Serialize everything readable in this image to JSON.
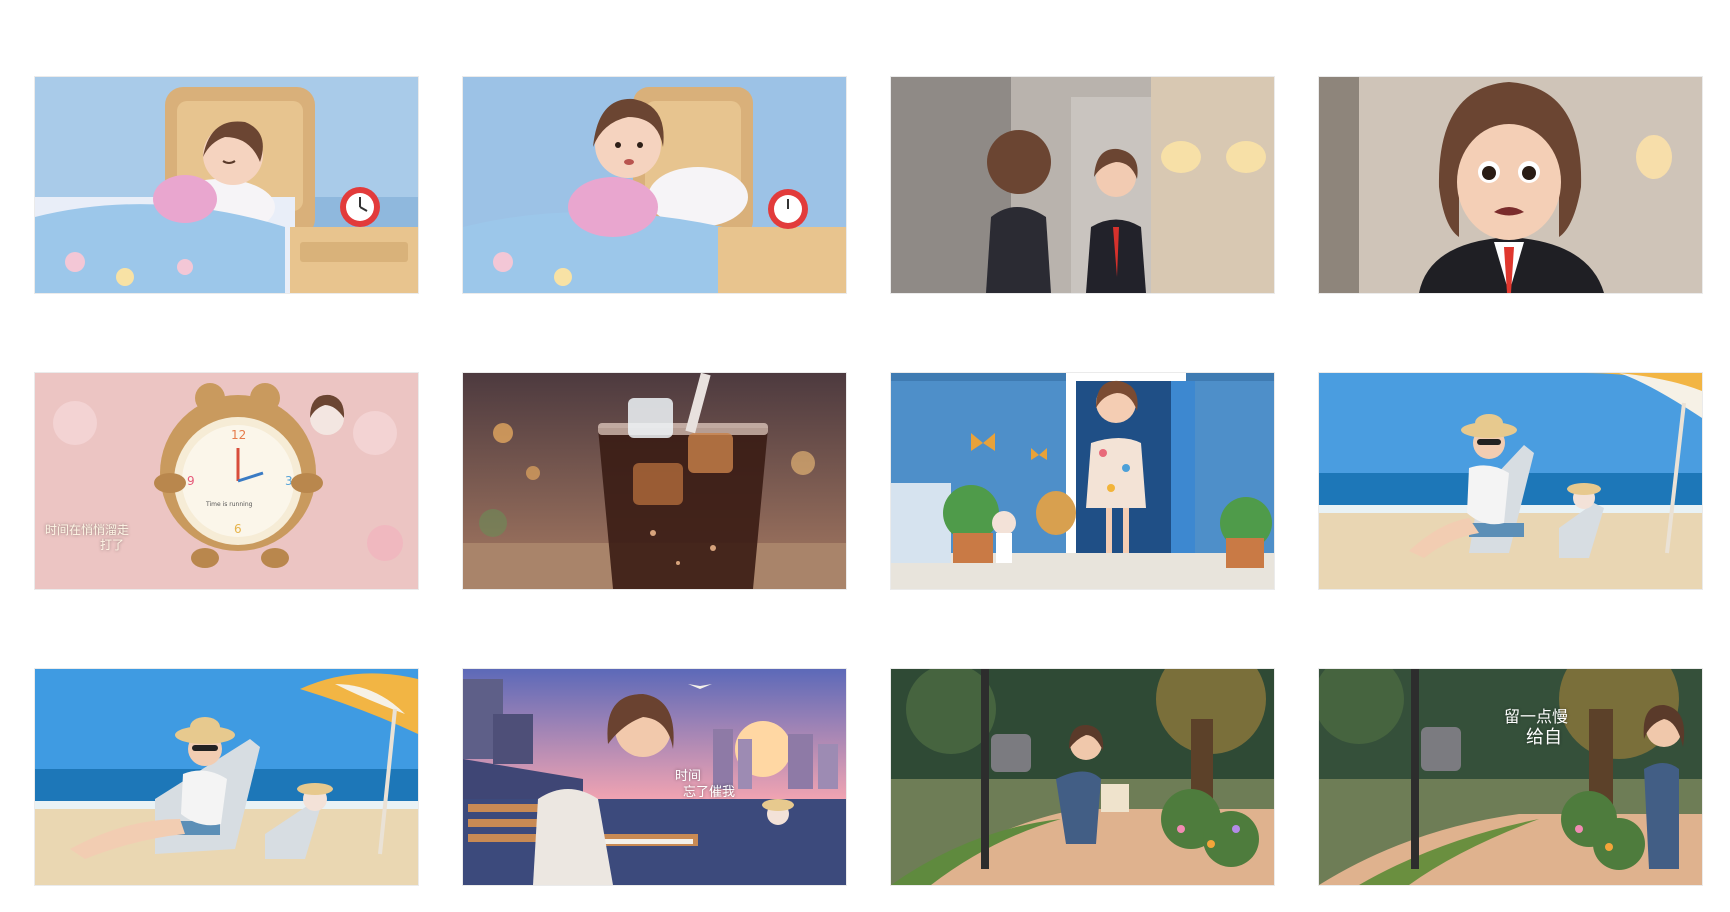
{
  "storyboard": {
    "frames": [
      {
        "scene": "girl-sleeping"
      },
      {
        "scene": "girl-waking-up"
      },
      {
        "scene": "girl-mirror-suit"
      },
      {
        "scene": "girl-worried-suit"
      },
      {
        "scene": "bear-clock",
        "caption_line1": "时间在悄悄溜走",
        "caption_line2": "打了",
        "clock_text": "Time is running"
      },
      {
        "scene": "iced-cola"
      },
      {
        "scene": "girl-doorway-butterflies"
      },
      {
        "scene": "beach-lounger-1"
      },
      {
        "scene": "beach-lounger-2"
      },
      {
        "scene": "rooftop-writing",
        "caption_line1": "时间",
        "caption_line2": "忘了催我"
      },
      {
        "scene": "mailbox-park"
      },
      {
        "scene": "mailbox-walk",
        "caption_line1": "留一点慢",
        "caption_line2": "给自"
      }
    ]
  }
}
